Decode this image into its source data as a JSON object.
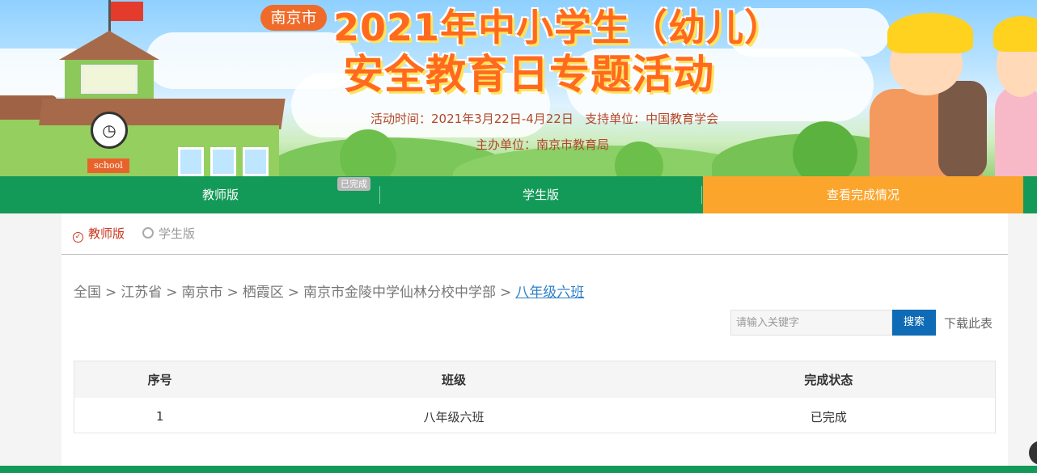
{
  "banner": {
    "city": "南京市",
    "title_line1": "2021年中小学生（幼儿）",
    "title_line2": "安全教育日专题活动",
    "info_line1": "活动时间：2021年3月22日-4月22日   支持单位：中国教育学会",
    "info_line2": "主办单位：南京市教育局",
    "school_sign": "school"
  },
  "nav": {
    "items": [
      {
        "label": "教师版"
      },
      {
        "label": "学生版"
      },
      {
        "label": "查看完成情况"
      }
    ],
    "done_tag": "已完成"
  },
  "tabs": {
    "teacher": "教师版",
    "student": "学生版"
  },
  "breadcrumb": {
    "items": [
      "全国",
      "江苏省",
      "南京市",
      "栖霞区",
      "南京市金陵中学仙林分校中学部"
    ],
    "current": "八年级六班",
    "separator": ">"
  },
  "search": {
    "placeholder": "请输入关键字",
    "button": "搜索",
    "download": "下载此表"
  },
  "table": {
    "headers": [
      "序号",
      "班级",
      "完成状态"
    ],
    "rows": [
      [
        "1",
        "八年级六班",
        "已完成"
      ]
    ]
  },
  "colors": {
    "nav_green": "#149a58",
    "nav_active_orange": "#fba52d",
    "accent_red": "#c8361e",
    "link_blue": "#2f80c8",
    "search_blue": "#0f6bb5"
  }
}
